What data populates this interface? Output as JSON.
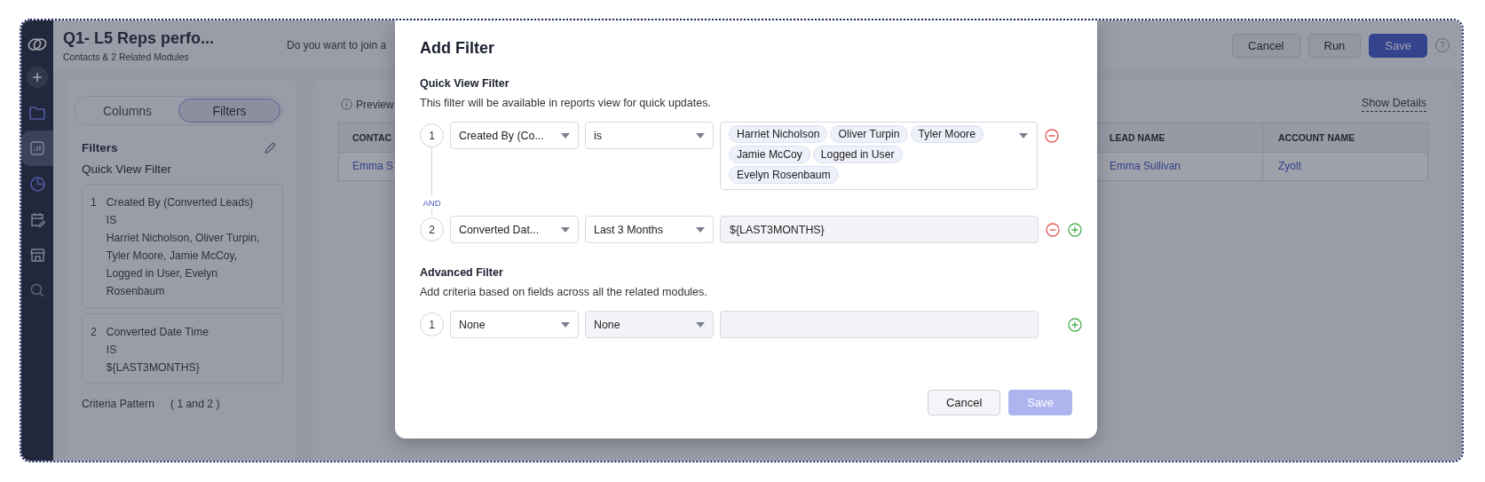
{
  "sidebar": {
    "items": [
      {
        "kind": "logo",
        "selected": false
      },
      {
        "kind": "plus",
        "selected": false
      },
      {
        "kind": "folder",
        "selected": false
      },
      {
        "kind": "chart",
        "selected": true
      },
      {
        "kind": "pie",
        "selected": false
      },
      {
        "kind": "calendar",
        "selected": false
      },
      {
        "kind": "store",
        "selected": false
      },
      {
        "kind": "search",
        "selected": false
      }
    ]
  },
  "header": {
    "title": "Q1- L5 Reps perfo...",
    "subtitle": "Contacts & 2 Related Modules",
    "notice": "Do you want to join a"
  },
  "actions": [
    {
      "label": "Cancel",
      "kind": "secondary"
    },
    {
      "label": "Run",
      "kind": "secondary"
    },
    {
      "label": "Save",
      "kind": "primary"
    }
  ],
  "help": "?",
  "left_panel": {
    "tabs": [
      {
        "label": "Columns",
        "selected": false
      },
      {
        "label": "Filters",
        "selected": true
      }
    ],
    "heading": "Filters",
    "section": "Quick View Filter",
    "filters": [
      {
        "number": "1",
        "field": "Created By (Converted Leads)",
        "operator": "IS",
        "value": "Harriet Nicholson, Oliver Turpin, Tyler Moore, Jamie McCoy, Logged in User, Evelyn Rosenbaum"
      },
      {
        "number": "2",
        "field": "Converted Date Time",
        "operator": "IS",
        "value": "${LAST3MONTHS}"
      }
    ],
    "criteria_label": "Criteria Pattern",
    "criteria_value": "( 1 and 2 )"
  },
  "preview": {
    "label": "Preview",
    "show_details": "Show Details",
    "table": {
      "columns": [
        "CONTAC",
        "LEAD NAME",
        "ACCOUNT NAME"
      ],
      "rows": [
        [
          "Emma S",
          "Emma Sullivan",
          "Zyolt"
        ]
      ]
    }
  },
  "dialog": {
    "title": "Add Filter",
    "quick": {
      "heading": "Quick View Filter",
      "description": "This filter will be available in reports view for quick updates.",
      "connector": "AND",
      "rows": [
        {
          "number": "1",
          "field": "Created By (Co...",
          "operator": "is",
          "kind": "tags",
          "tags": [
            "Harriet Nicholson",
            "Oliver Turpin",
            "Tyler Moore",
            "Jamie McCoy",
            "Logged in User",
            "Evelyn Rosenbaum"
          ],
          "removable": true,
          "addable": false
        },
        {
          "number": "2",
          "field": "Converted Dat...",
          "operator": "Last 3 Months",
          "kind": "text",
          "value": "${LAST3MONTHS}",
          "value_disabled": true,
          "removable": true,
          "addable": true
        }
      ]
    },
    "advanced": {
      "heading": "Advanced Filter",
      "description": "Add criteria based on fields across all the related modules.",
      "rows": [
        {
          "number": "1",
          "field": "None",
          "operator": "None",
          "operator_disabled": true,
          "kind": "text",
          "value_disabled": true,
          "removable": false,
          "addable": true
        }
      ]
    },
    "buttons": [
      {
        "label": "Cancel",
        "kind": "secondary",
        "disabled": false
      },
      {
        "label": "Save",
        "kind": "primary",
        "disabled": true
      }
    ]
  }
}
